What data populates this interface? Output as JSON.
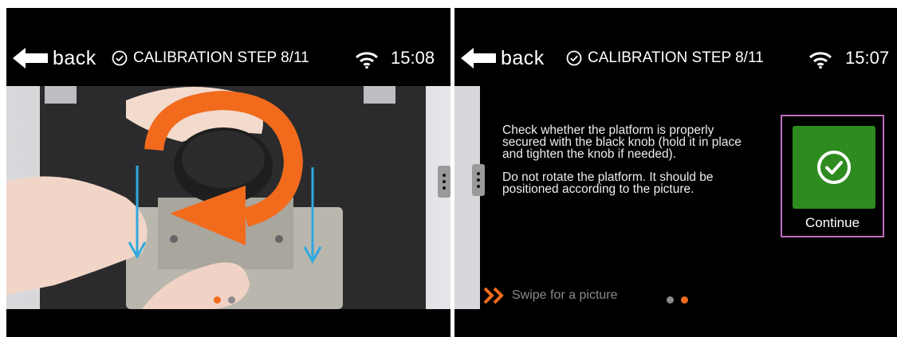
{
  "left_screen": {
    "back_label": "back",
    "title": "CALIBRATION STEP 8/11",
    "time": "15:08",
    "page_dots": {
      "count": 2,
      "active_index": 0
    }
  },
  "right_screen": {
    "back_label": "back",
    "title": "CALIBRATION STEP 8/11",
    "time": "15:07",
    "instructions": [
      "Check whether the platform is properly secured with the black knob (hold it in place and tighten the knob if needed).",
      "Do not rotate the platform. It should be positioned according to the picture."
    ],
    "continue_label": "Continue",
    "swipe_hint": "Swipe for a picture",
    "page_dots": {
      "count": 2,
      "active_index": 1
    }
  },
  "colors": {
    "accent_orange": "#f26b1d",
    "continue_green": "#2e8b1f",
    "highlight_frame": "#c06bbd",
    "arrow_blue": "#2fa9e0"
  },
  "icons": [
    "back-arrow-icon",
    "check-circle-icon",
    "wifi-icon",
    "drag-handle-icon",
    "check-icon",
    "double-chevron-icon"
  ]
}
